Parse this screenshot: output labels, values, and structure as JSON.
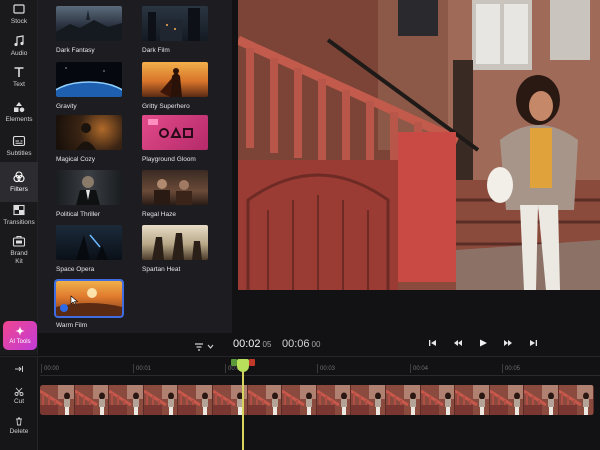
{
  "rail": {
    "items": [
      {
        "label": "Stock",
        "icon": "stock-icon"
      },
      {
        "label": "Audio",
        "icon": "music-note-icon"
      },
      {
        "label": "Text",
        "icon": "text-icon"
      },
      {
        "label": "Elements",
        "icon": "shapes-icon"
      },
      {
        "label": "Subtitles",
        "icon": "subtitles-icon"
      },
      {
        "label": "Filters",
        "icon": "filters-icon"
      },
      {
        "label": "Transitions",
        "icon": "transitions-icon"
      },
      {
        "label": "Brand\nKit",
        "icon": "brand-kit-icon"
      }
    ],
    "active": "Filters",
    "ai_tools_label": "AI Tools"
  },
  "filters": {
    "items": [
      {
        "name": "Dark Fantasy"
      },
      {
        "name": "Dark Film"
      },
      {
        "name": "Gravity"
      },
      {
        "name": "Gritty Superhero"
      },
      {
        "name": "Magical Cozy"
      },
      {
        "name": "Playground Gloom"
      },
      {
        "name": "Political Thriller"
      },
      {
        "name": "Regal Haze"
      },
      {
        "name": "Space Opera"
      },
      {
        "name": "Spartan Heat"
      },
      {
        "name": "Warm Film"
      }
    ],
    "selected": "Warm Film"
  },
  "player": {
    "current_time": "00:02",
    "current_frames": "05",
    "total_time": "00:06",
    "total_frames": "00"
  },
  "timeline": {
    "ticks": [
      "00:00",
      "00:01",
      "00:02",
      "00:03",
      "00:04",
      "00:05"
    ],
    "tools": [
      {
        "label": "Cut",
        "icon": "scissors-icon"
      },
      {
        "label": "Delete",
        "icon": "trash-icon"
      }
    ],
    "frame_count": 16
  },
  "colors": {
    "accent": "#3f6de0",
    "ai_gradient_start": "#f0468f",
    "ai_gradient_end": "#c13bd8",
    "playhead": "#b8e05a",
    "clip": "#7a3b34"
  }
}
